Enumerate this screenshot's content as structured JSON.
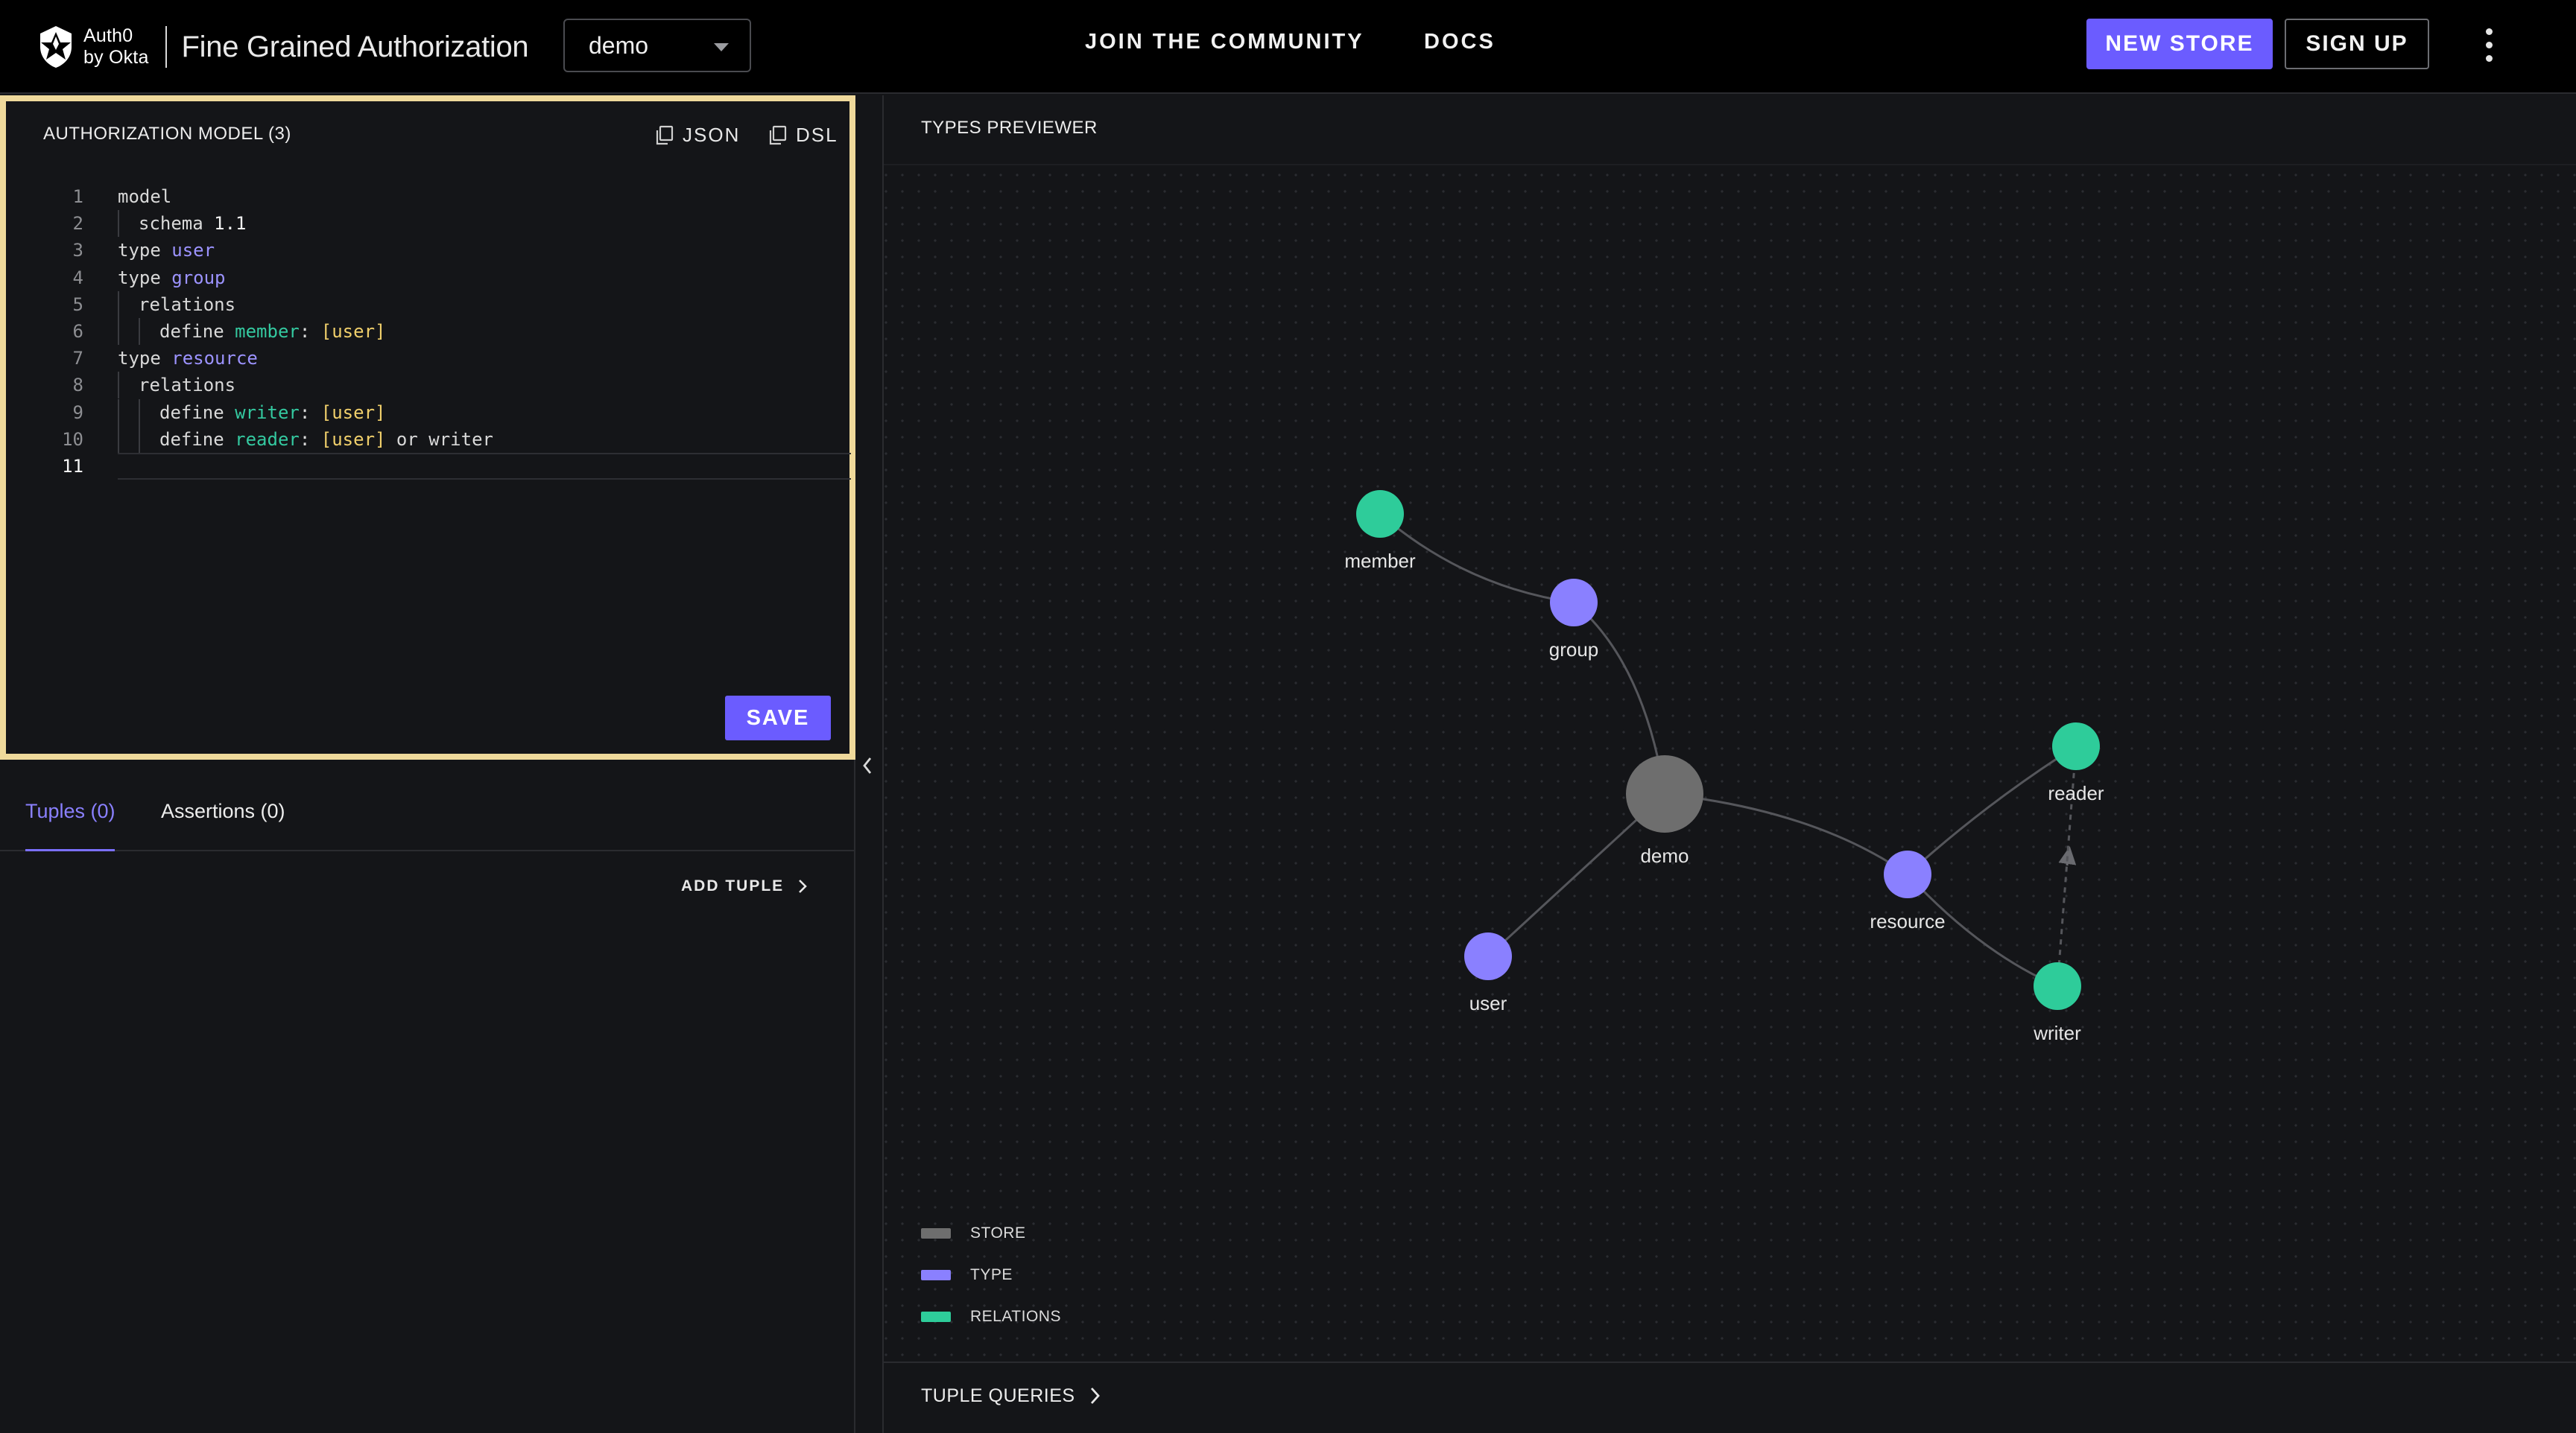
{
  "header": {
    "brand_line1": "Auth0",
    "brand_line2": "by Okta",
    "product_name": "Fine Grained Authorization",
    "store_selected": "demo",
    "nav_community": "JOIN  THE COMMUNITY",
    "nav_docs": "DOCS",
    "new_store_label": "NEW STORE",
    "sign_up_label": "SIGN UP"
  },
  "editor": {
    "title": "AUTHORIZATION MODEL (3)",
    "json_label": "JSON",
    "dsl_label": "DSL",
    "save_label": "SAVE",
    "lines": [
      {
        "n": "1",
        "indent": 0,
        "tokens": [
          {
            "t": "model",
            "c": "plain"
          }
        ]
      },
      {
        "n": "2",
        "indent": 1,
        "tokens": [
          {
            "t": "schema ",
            "c": "plain"
          },
          {
            "t": "1.1",
            "c": "num"
          }
        ]
      },
      {
        "n": "3",
        "indent": 0,
        "tokens": [
          {
            "t": "type ",
            "c": "plain"
          },
          {
            "t": "user",
            "c": "type"
          }
        ]
      },
      {
        "n": "4",
        "indent": 0,
        "tokens": [
          {
            "t": "type ",
            "c": "plain"
          },
          {
            "t": "group",
            "c": "type"
          }
        ]
      },
      {
        "n": "5",
        "indent": 1,
        "tokens": [
          {
            "t": "relations",
            "c": "plain"
          }
        ]
      },
      {
        "n": "6",
        "indent": 2,
        "tokens": [
          {
            "t": "define ",
            "c": "plain"
          },
          {
            "t": "member",
            "c": "rel"
          },
          {
            "t": ": ",
            "c": "plain"
          },
          {
            "t": "[user]",
            "c": "br"
          }
        ]
      },
      {
        "n": "7",
        "indent": 0,
        "tokens": [
          {
            "t": "type ",
            "c": "plain"
          },
          {
            "t": "resource",
            "c": "type"
          }
        ]
      },
      {
        "n": "8",
        "indent": 1,
        "tokens": [
          {
            "t": "relations",
            "c": "plain"
          }
        ]
      },
      {
        "n": "9",
        "indent": 2,
        "tokens": [
          {
            "t": "define ",
            "c": "plain"
          },
          {
            "t": "writer",
            "c": "rel"
          },
          {
            "t": ": ",
            "c": "plain"
          },
          {
            "t": "[user]",
            "c": "br"
          }
        ]
      },
      {
        "n": "10",
        "indent": 2,
        "tokens": [
          {
            "t": "define ",
            "c": "plain"
          },
          {
            "t": "reader",
            "c": "rel"
          },
          {
            "t": ": ",
            "c": "plain"
          },
          {
            "t": "[user]",
            "c": "br"
          },
          {
            "t": " or writer",
            "c": "plain"
          }
        ]
      },
      {
        "n": "11",
        "indent": 0,
        "tokens": [],
        "current": true
      }
    ]
  },
  "tuples": {
    "tab_tuples": "Tuples (0)",
    "tab_assertions": "Assertions (0)",
    "add_tuple_label": "ADD TUPLE"
  },
  "previewer": {
    "title": "TYPES PREVIEWER",
    "nodes": [
      {
        "id": "member",
        "label": "member",
        "kind": "relation"
      },
      {
        "id": "group",
        "label": "group",
        "kind": "type"
      },
      {
        "id": "demo",
        "label": "demo",
        "kind": "store"
      },
      {
        "id": "user",
        "label": "user",
        "kind": "type"
      },
      {
        "id": "resource",
        "label": "resource",
        "kind": "type"
      },
      {
        "id": "reader",
        "label": "reader",
        "kind": "relation"
      },
      {
        "id": "writer",
        "label": "writer",
        "kind": "relation"
      }
    ],
    "edges": [
      {
        "from": "member",
        "to": "group"
      },
      {
        "from": "group",
        "to": "demo"
      },
      {
        "from": "demo",
        "to": "user"
      },
      {
        "from": "demo",
        "to": "resource"
      },
      {
        "from": "resource",
        "to": "reader"
      },
      {
        "from": "resource",
        "to": "writer"
      },
      {
        "from": "writer",
        "to": "reader",
        "style": "dashed"
      }
    ],
    "legend": [
      {
        "label": "STORE",
        "color": "#6e6e6e"
      },
      {
        "label": "TYPE",
        "color": "#8a80ff"
      },
      {
        "label": "RELATIONS",
        "color": "#2ecc9a"
      }
    ],
    "tuple_queries_label": "TUPLE QUERIES"
  },
  "colors": {
    "accent": "#6b5cff",
    "store": "#6e6e6e",
    "type": "#8a80ff",
    "relation": "#2ecc9a",
    "editor_border": "#efd99b"
  },
  "icons": {
    "brand": "auth0-shield-icon",
    "copy": "copy-icon",
    "chevron_right": "chevron-right-icon",
    "chevron_left": "chevron-left-icon",
    "more": "more-vertical-icon",
    "caret": "caret-down-icon"
  }
}
